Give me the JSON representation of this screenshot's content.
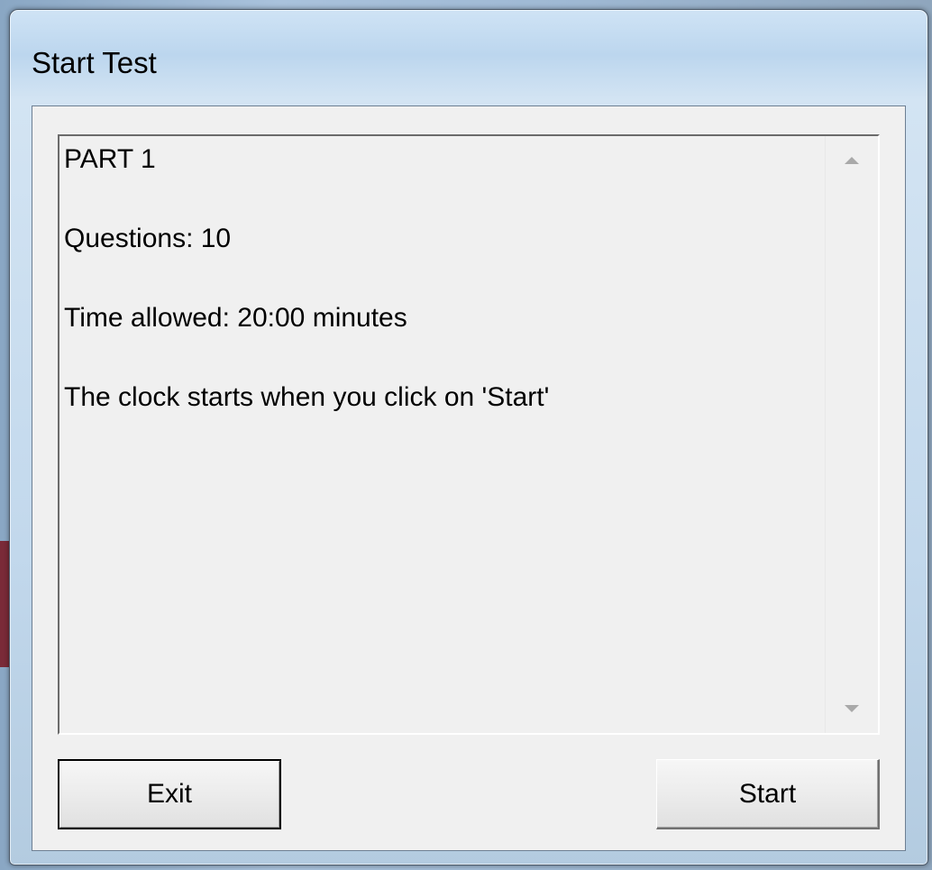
{
  "window": {
    "title": "Start Test"
  },
  "info": {
    "lines": [
      "PART 1",
      "Questions: 10",
      "Time allowed: 20:00 minutes",
      "The clock starts when you click on 'Start'"
    ]
  },
  "buttons": {
    "exit_label": "Exit",
    "start_label": "Start"
  },
  "icons": {
    "scroll_up": "scroll-up-arrow-icon",
    "scroll_down": "scroll-down-arrow-icon"
  },
  "colors": {
    "dialog_background": "#f0f0f0",
    "title_bar": "#bcd6ee"
  }
}
